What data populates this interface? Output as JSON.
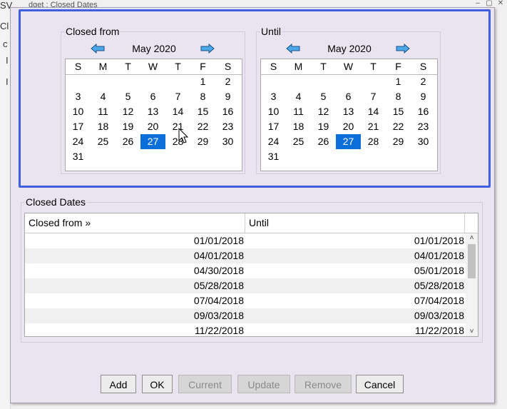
{
  "backdrop": {
    "title_fragment": "dget : Closed Dates",
    "sidebar_fragments": [
      "SV",
      "Cl",
      "c",
      "I",
      "I"
    ]
  },
  "dialog": {
    "closed_from": {
      "caption": "Closed from",
      "month": "May 2020",
      "weekdays": [
        "S",
        "M",
        "T",
        "W",
        "T",
        "F",
        "S"
      ],
      "days": [
        "1",
        "2",
        "3",
        "4",
        "5",
        "6",
        "7",
        "8",
        "9",
        "10",
        "11",
        "12",
        "13",
        "14",
        "15",
        "16",
        "17",
        "18",
        "19",
        "20",
        "21",
        "22",
        "23",
        "24",
        "25",
        "26",
        "27",
        "28",
        "29",
        "30",
        "31"
      ],
      "selected_day": "27"
    },
    "until": {
      "caption": "Until",
      "month": "May 2020",
      "weekdays": [
        "S",
        "M",
        "T",
        "W",
        "T",
        "F",
        "S"
      ],
      "days": [
        "1",
        "2",
        "3",
        "4",
        "5",
        "6",
        "7",
        "8",
        "9",
        "10",
        "11",
        "12",
        "13",
        "14",
        "15",
        "16",
        "17",
        "18",
        "19",
        "20",
        "21",
        "22",
        "23",
        "24",
        "25",
        "26",
        "27",
        "28",
        "29",
        "30",
        "31"
      ],
      "selected_day": "27"
    },
    "closed_dates": {
      "caption": "Closed Dates",
      "columns": [
        "Closed from »",
        "Until"
      ],
      "rows": [
        [
          "01/01/2018",
          "01/01/2018"
        ],
        [
          "04/01/2018",
          "04/01/2018"
        ],
        [
          "04/30/2018",
          "05/01/2018"
        ],
        [
          "05/28/2018",
          "05/28/2018"
        ],
        [
          "07/04/2018",
          "07/04/2018"
        ],
        [
          "09/03/2018",
          "09/03/2018"
        ],
        [
          "11/22/2018",
          "11/22/2018"
        ]
      ]
    },
    "buttons": {
      "add": "Add",
      "ok": "OK",
      "current": "Current",
      "update": "Update",
      "remove": "Remove",
      "cancel": "Cancel"
    }
  },
  "colors": {
    "highlight_border": "#3f5fe0",
    "selected_day": "#0a6fd8",
    "dialog_bg": "#eae4f1",
    "nav_arrow": "#4aa8e8"
  }
}
